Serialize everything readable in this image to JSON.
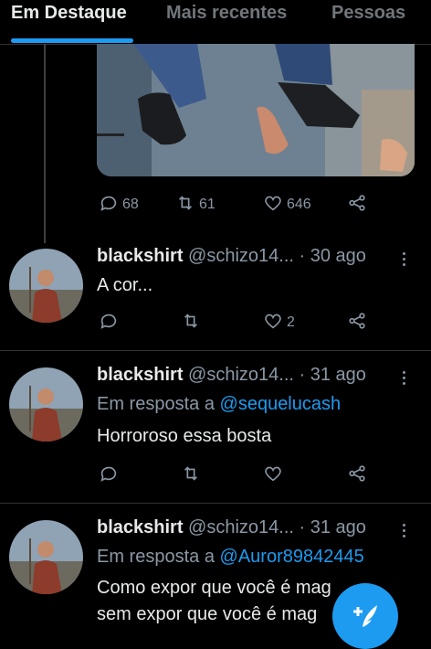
{
  "tabs": [
    {
      "label": "Em Destaque",
      "active": true
    },
    {
      "label": "Mais recentes",
      "active": false
    },
    {
      "label": "Pessoas",
      "active": false
    }
  ],
  "top_tweet": {
    "replies": "68",
    "retweets": "61",
    "likes": "646"
  },
  "tweets": [
    {
      "name": "blackshirt",
      "handle": "@schizo14...",
      "time": "· 30 ago",
      "reply_prefix": "",
      "reply_to": "",
      "text_lines": [
        "A cor..."
      ],
      "replies": "",
      "retweets": "",
      "likes": "2"
    },
    {
      "name": "blackshirt",
      "handle": "@schizo14...",
      "time": "· 31 ago",
      "reply_prefix": "Em resposta a",
      "reply_to": "@sequelucash",
      "text_lines": [
        "Horroroso essa bosta"
      ],
      "replies": "",
      "retweets": "",
      "likes": ""
    },
    {
      "name": "blackshirt",
      "handle": "@schizo14...",
      "time": "· 31 ago",
      "reply_prefix": "Em resposta a",
      "reply_to": "@Auror89842445",
      "text_lines": [
        "Como expor que você é mag",
        "sem expor que você é mag"
      ],
      "replies": "",
      "retweets": "",
      "likes": ""
    }
  ],
  "colors": {
    "accent": "#1d9bf0",
    "background": "#000000",
    "secondary_text": "#8b98a5"
  },
  "icons": [
    "reply-icon",
    "retweet-icon",
    "like-icon",
    "share-icon",
    "more-icon",
    "compose-icon"
  ]
}
